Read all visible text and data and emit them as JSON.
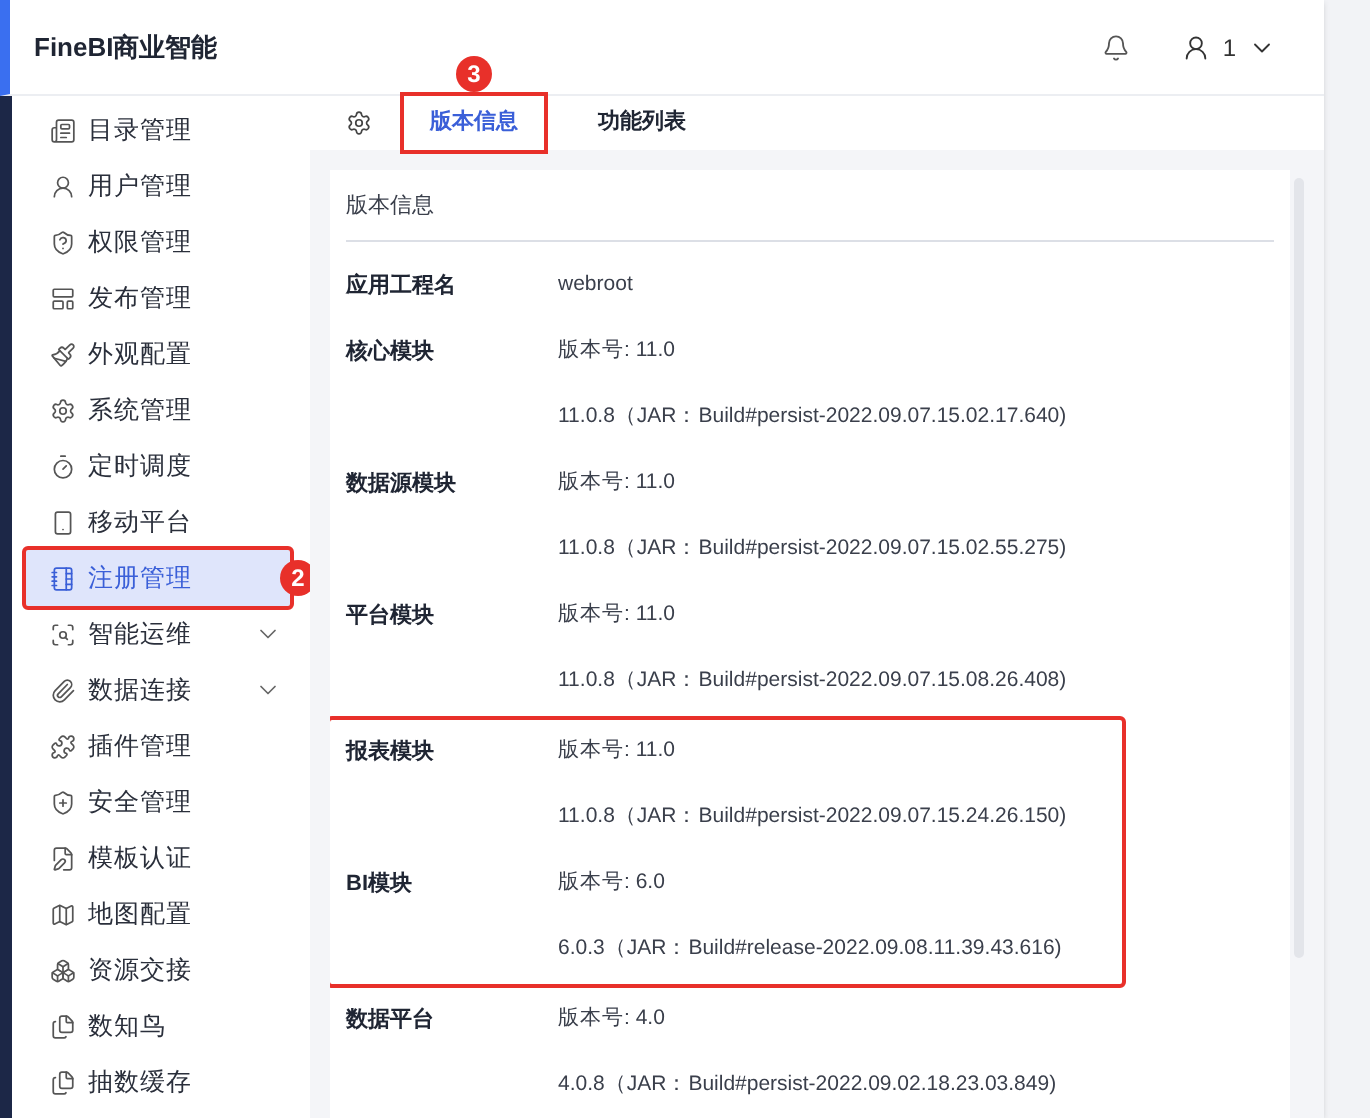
{
  "header": {
    "brand": "FineBI商业智能",
    "user": "1"
  },
  "sidebar": {
    "items": [
      {
        "label": "目录管理",
        "kind": "link",
        "selected": false,
        "highlighted": false
      },
      {
        "label": "用户管理",
        "kind": "link",
        "selected": false,
        "highlighted": false
      },
      {
        "label": "权限管理",
        "kind": "link",
        "selected": false,
        "highlighted": false
      },
      {
        "label": "发布管理",
        "kind": "link",
        "selected": false,
        "highlighted": false
      },
      {
        "label": "外观配置",
        "kind": "link",
        "selected": false,
        "highlighted": false
      },
      {
        "label": "系统管理",
        "kind": "link",
        "selected": false,
        "highlighted": false
      },
      {
        "label": "定时调度",
        "kind": "link",
        "selected": false,
        "highlighted": false
      },
      {
        "label": "移动平台",
        "kind": "link",
        "selected": false,
        "highlighted": false
      },
      {
        "label": "注册管理",
        "kind": "link",
        "selected": true,
        "highlighted": true,
        "marker": "2"
      },
      {
        "label": "智能运维",
        "kind": "group",
        "selected": false,
        "highlighted": false
      },
      {
        "label": "数据连接",
        "kind": "group",
        "selected": false,
        "highlighted": false
      },
      {
        "label": "插件管理",
        "kind": "link",
        "selected": false,
        "highlighted": false
      },
      {
        "label": "安全管理",
        "kind": "link",
        "selected": false,
        "highlighted": false
      },
      {
        "label": "模板认证",
        "kind": "link",
        "selected": false,
        "highlighted": false
      },
      {
        "label": "地图配置",
        "kind": "link",
        "selected": false,
        "highlighted": false
      },
      {
        "label": "资源交接",
        "kind": "link",
        "selected": false,
        "highlighted": false
      },
      {
        "label": "数知鸟",
        "kind": "link",
        "selected": false,
        "highlighted": false
      },
      {
        "label": "抽数缓存",
        "kind": "link",
        "selected": false,
        "highlighted": false
      }
    ]
  },
  "tabs": [
    {
      "label": "版本信息",
      "selected": true,
      "highlighted": true,
      "marker": "3"
    },
    {
      "label": "功能列表",
      "selected": false,
      "highlighted": false
    }
  ],
  "panel": {
    "title": "版本信息",
    "modules": [
      {
        "name": "应用工程名",
        "lines": [
          "webroot"
        ],
        "highlighted": false
      },
      {
        "name": "核心模块",
        "lines": [
          "版本号: 11.0",
          "11.0.8（JAR：Build#persist-2022.09.07.15.02.17.640)"
        ],
        "highlighted": false
      },
      {
        "name": "数据源模块",
        "lines": [
          "版本号: 11.0",
          "11.0.8（JAR：Build#persist-2022.09.07.15.02.55.275)"
        ],
        "highlighted": false
      },
      {
        "name": "平台模块",
        "lines": [
          "版本号: 11.0",
          "11.0.8（JAR：Build#persist-2022.09.07.15.08.26.408)"
        ],
        "highlighted": false
      },
      {
        "name": "报表模块",
        "lines": [
          "版本号: 11.0",
          "11.0.8（JAR：Build#persist-2022.09.07.15.24.26.150)"
        ],
        "highlighted": true
      },
      {
        "name": "BI模块",
        "lines": [
          "版本号: 6.0",
          "6.0.3（JAR：Build#release-2022.09.08.11.39.43.616)"
        ],
        "highlighted": true
      },
      {
        "name": "数据平台",
        "lines": [
          "版本号: 4.0",
          "4.0.8（JAR：Build#persist-2022.09.02.18.23.03.849)"
        ],
        "highlighted": false
      }
    ]
  }
}
